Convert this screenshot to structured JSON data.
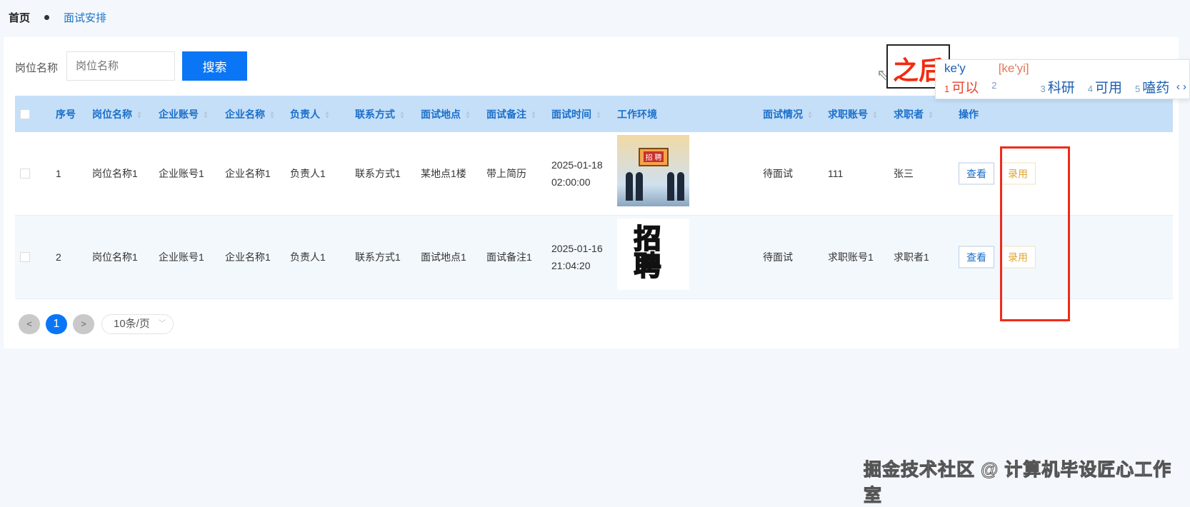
{
  "breadcrumb": {
    "home": "首页",
    "current": "面试安排"
  },
  "search": {
    "label": "岗位名称",
    "placeholder": "岗位名称",
    "button": "搜索"
  },
  "table": {
    "headers": [
      "序号",
      "岗位名称",
      "企业账号",
      "企业名称",
      "负责人",
      "联系方式",
      "面试地点",
      "面试备注",
      "面试时间",
      "工作环境",
      "面试情况",
      "求职账号",
      "求职者",
      "操作"
    ],
    "rows": [
      {
        "index": "1",
        "job": "岗位名称1",
        "company_account": "企业账号1",
        "company_name": "企业名称1",
        "manager": "负责人1",
        "contact": "联系方式1",
        "location": "某地点1楼",
        "note": "带上简历",
        "date": "2025-01-18",
        "time": "02:00:00",
        "image_text": "招 聘",
        "status": "待面试",
        "seeker_account": "111",
        "seeker": "张三"
      },
      {
        "index": "2",
        "job": "岗位名称1",
        "company_account": "企业账号1",
        "company_name": "企业名称1",
        "manager": "负责人1",
        "contact": "联系方式1",
        "location": "面试地点1",
        "note": "面试备注1",
        "date": "2025-01-16",
        "time": "21:04:20",
        "image_text": "招聘",
        "status": "待面试",
        "seeker_account": "求职账号1",
        "seeker": "求职者1"
      }
    ],
    "actions": {
      "view": "查看",
      "hire": "录用"
    }
  },
  "pagination": {
    "prev": "<",
    "current": "1",
    "next": ">",
    "page_size": "10条/页"
  },
  "overlay": {
    "annotation": "之后",
    "ime_input": "ke'y",
    "ime_pinyin": "[ke'yi]",
    "candidates": [
      {
        "n": "1",
        "t": "可以"
      },
      {
        "n": "2",
        "t": ""
      },
      {
        "n": "3",
        "t": "科研"
      },
      {
        "n": "4",
        "t": "可用"
      },
      {
        "n": "5",
        "t": "嗑药"
      }
    ]
  },
  "watermark": "掘金技术社区 @ 计算机毕设匠心工作室",
  "colors": {
    "primary": "#0a76f6",
    "header_bg": "#c5dff9",
    "highlight": "#ef2b1a",
    "hire": "#e0a531"
  }
}
